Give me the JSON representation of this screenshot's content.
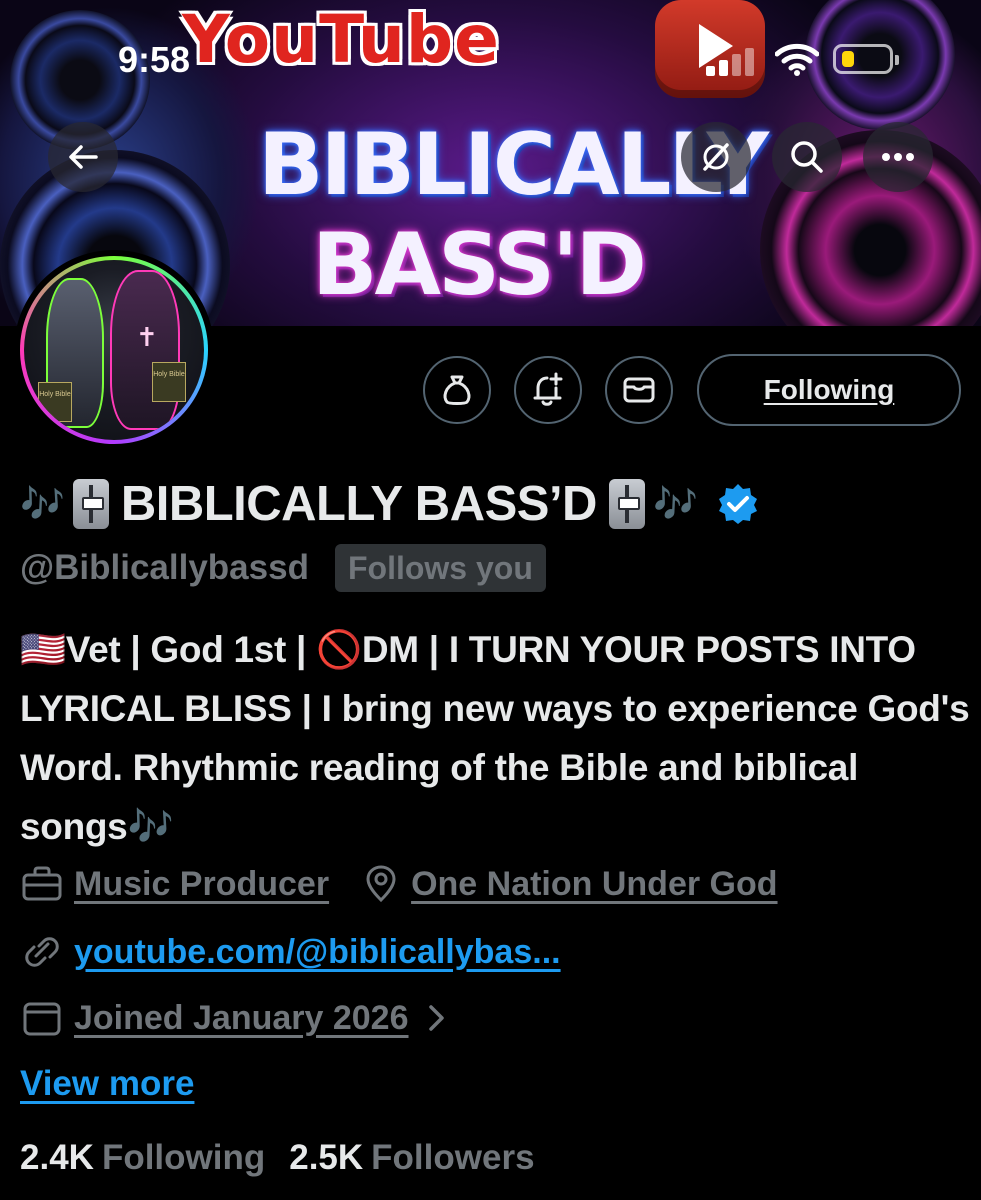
{
  "status_bar": {
    "time": "9:58"
  },
  "banner": {
    "logo_text": "YouTube",
    "headline_line1": "BIBLICALLY",
    "headline_line2": "BASS'D"
  },
  "nav": {
    "back_icon": "back-arrow-icon",
    "grok_icon": "grok-icon",
    "search_icon": "search-icon",
    "more_icon": "more-icon"
  },
  "avatar": {
    "book_label": "Holy Bible"
  },
  "actions": {
    "tip_icon": "money-bag-icon",
    "notify_icon": "bell-plus-icon",
    "message_icon": "envelope-icon",
    "follow_label": "Following"
  },
  "profile": {
    "name_prefix_emoji": "🎶",
    "display_name": "BIBLICALLY BASS’D",
    "name_suffix_emoji": "🎶",
    "handle": "@Biblicallybassd",
    "follows_you": "Follows you",
    "verified_color": "#1d9bf0",
    "bio_parts": [
      "🇺🇸Vet | God 1st | ",
      "🚫",
      "DM | I TURN YOUR POSTS INTO LYRICAL BLISS | I bring new ways to experience God's Word. Rhythmic reading of the Bible and biblical songs",
      "🎶"
    ],
    "category": "Music Producer",
    "location": "One Nation Under God",
    "website": "youtube.com/@biblicallybas...",
    "joined": "Joined January 2026",
    "view_more": "View more"
  },
  "stats": {
    "following_count": "2.4K",
    "following_label": "Following",
    "followers_count": "2.5K",
    "followers_label": "Followers"
  },
  "colors": {
    "background": "#000000",
    "text_primary": "#e7e9ea",
    "text_secondary": "#71767b",
    "link": "#1d9bf0",
    "border": "#536471"
  }
}
